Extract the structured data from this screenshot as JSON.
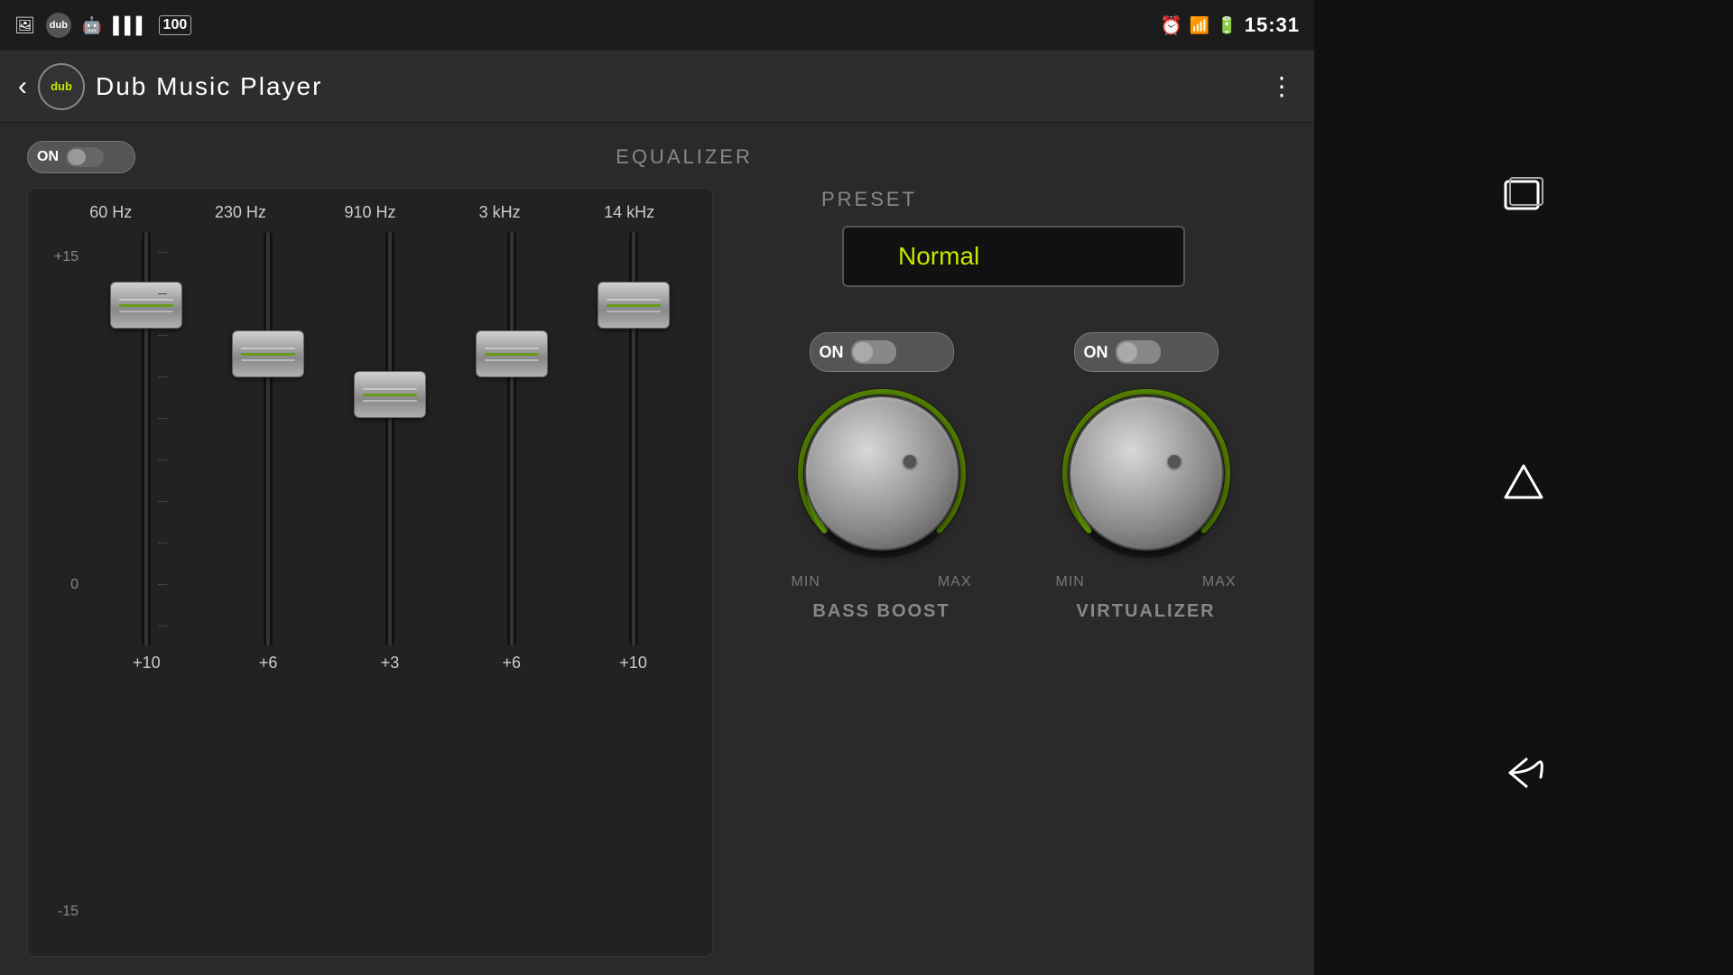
{
  "statusBar": {
    "time": "15:31",
    "icons": [
      "photo-icon",
      "dub-icon",
      "android-icon",
      "barcode-icon",
      "hundred-icon",
      "alarm-icon",
      "signal-icon",
      "battery-icon"
    ]
  },
  "header": {
    "backLabel": "‹",
    "logoText": "dub",
    "title": "Dub  Music  Player",
    "menuIcon": "⋮"
  },
  "equalizer": {
    "toggleLabel": "ON",
    "sectionTitle": "EQUALIZER",
    "presetTitle": "PRESET",
    "presetValue": "Normal",
    "scaleLabels": [
      "+15",
      "0",
      "-15"
    ],
    "bands": [
      {
        "freq": "60 Hz",
        "value": "+10",
        "position": 20
      },
      {
        "freq": "230 Hz",
        "value": "+6",
        "position": 35
      },
      {
        "freq": "910 Hz",
        "value": "+3",
        "position": 45
      },
      {
        "freq": "3 kHz",
        "value": "+6",
        "position": 35
      },
      {
        "freq": "14 kHz",
        "value": "+10",
        "position": 20
      }
    ]
  },
  "bassBoost": {
    "toggleLabel": "ON",
    "minLabel": "MIN",
    "maxLabel": "MAX",
    "sectionLabel": "BASS BOOST"
  },
  "virtualizer": {
    "toggleLabel": "ON",
    "minLabel": "MIN",
    "maxLabel": "MAX",
    "sectionLabel": "VIRTUALIZER"
  },
  "navButtons": {
    "windowLabel": "□",
    "homeLabel": "△",
    "backLabel": "←"
  }
}
